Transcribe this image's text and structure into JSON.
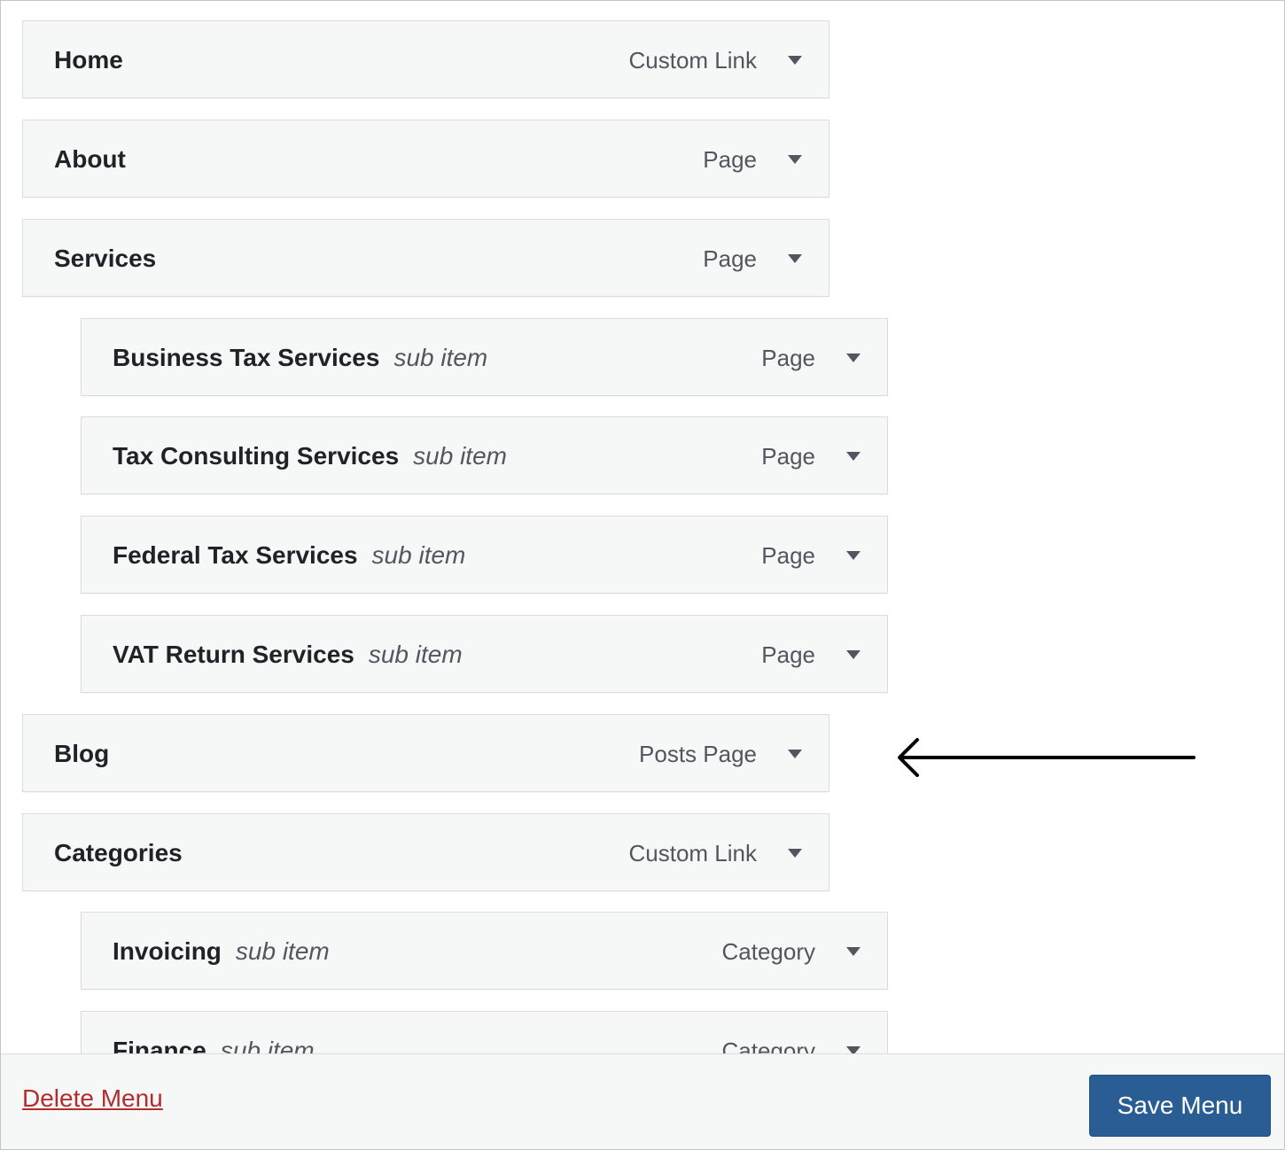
{
  "menu": {
    "items": [
      {
        "title": "Home",
        "sub": "",
        "type": "Custom Link",
        "depth": 0
      },
      {
        "title": "About",
        "sub": "",
        "type": "Page",
        "depth": 0
      },
      {
        "title": "Services",
        "sub": "",
        "type": "Page",
        "depth": 0
      },
      {
        "title": "Business Tax Services",
        "sub": "sub item",
        "type": "Page",
        "depth": 1
      },
      {
        "title": "Tax Consulting Services",
        "sub": "sub item",
        "type": "Page",
        "depth": 1
      },
      {
        "title": "Federal Tax Services",
        "sub": "sub item",
        "type": "Page",
        "depth": 1
      },
      {
        "title": "VAT Return Services",
        "sub": "sub item",
        "type": "Page",
        "depth": 1
      },
      {
        "title": "Blog",
        "sub": "",
        "type": "Posts Page",
        "depth": 0
      },
      {
        "title": "Categories",
        "sub": "",
        "type": "Custom Link",
        "depth": 0
      },
      {
        "title": "Invoicing",
        "sub": "sub item",
        "type": "Category",
        "depth": 1
      },
      {
        "title": "Finance",
        "sub": "sub item",
        "type": "Category",
        "depth": 1
      }
    ]
  },
  "footer": {
    "delete_label": "Delete Menu",
    "save_label": "Save Menu"
  },
  "annotation": {
    "arrow_icon": "left-arrow-icon",
    "color": "#000000"
  },
  "colors": {
    "save_button": "#2a5d93",
    "delete_link": "#b32d2e",
    "item_background": "#f6f7f7"
  }
}
